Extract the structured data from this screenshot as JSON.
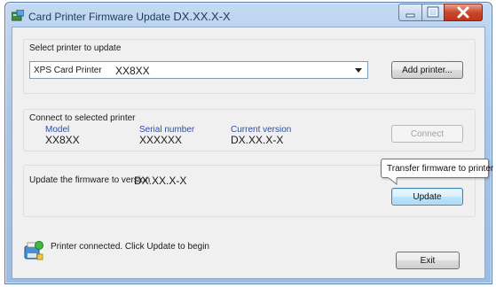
{
  "window": {
    "title_prefix": "Card Printer Firmware Update",
    "title_version": "DX.XX.X-X"
  },
  "select_section": {
    "label": "Select printer to update",
    "printer_name": "XPS Card Printer",
    "printer_model": "XX8XX",
    "add_printer_label": "Add printer..."
  },
  "connect_section": {
    "label": "Connect to selected printer",
    "columns": [
      {
        "header": "Model",
        "value": "XX8XX"
      },
      {
        "header": "Serial number",
        "value": "XXXXXX"
      },
      {
        "header": "Current version",
        "value": "DX.XX.X-X"
      }
    ],
    "connect_label": "Connect"
  },
  "update_section": {
    "label": "Update the firmware to version",
    "version": "DX.XX.X-X",
    "tooltip": "Transfer firmware to printer",
    "update_label": "Update"
  },
  "status": {
    "message": "Printer connected. Click Update to begin"
  },
  "footer": {
    "exit_label": "Exit"
  },
  "colors": {
    "header_blue": "#2a4ea8",
    "title_text": "#1e395b",
    "close_red": "#c9472c"
  }
}
